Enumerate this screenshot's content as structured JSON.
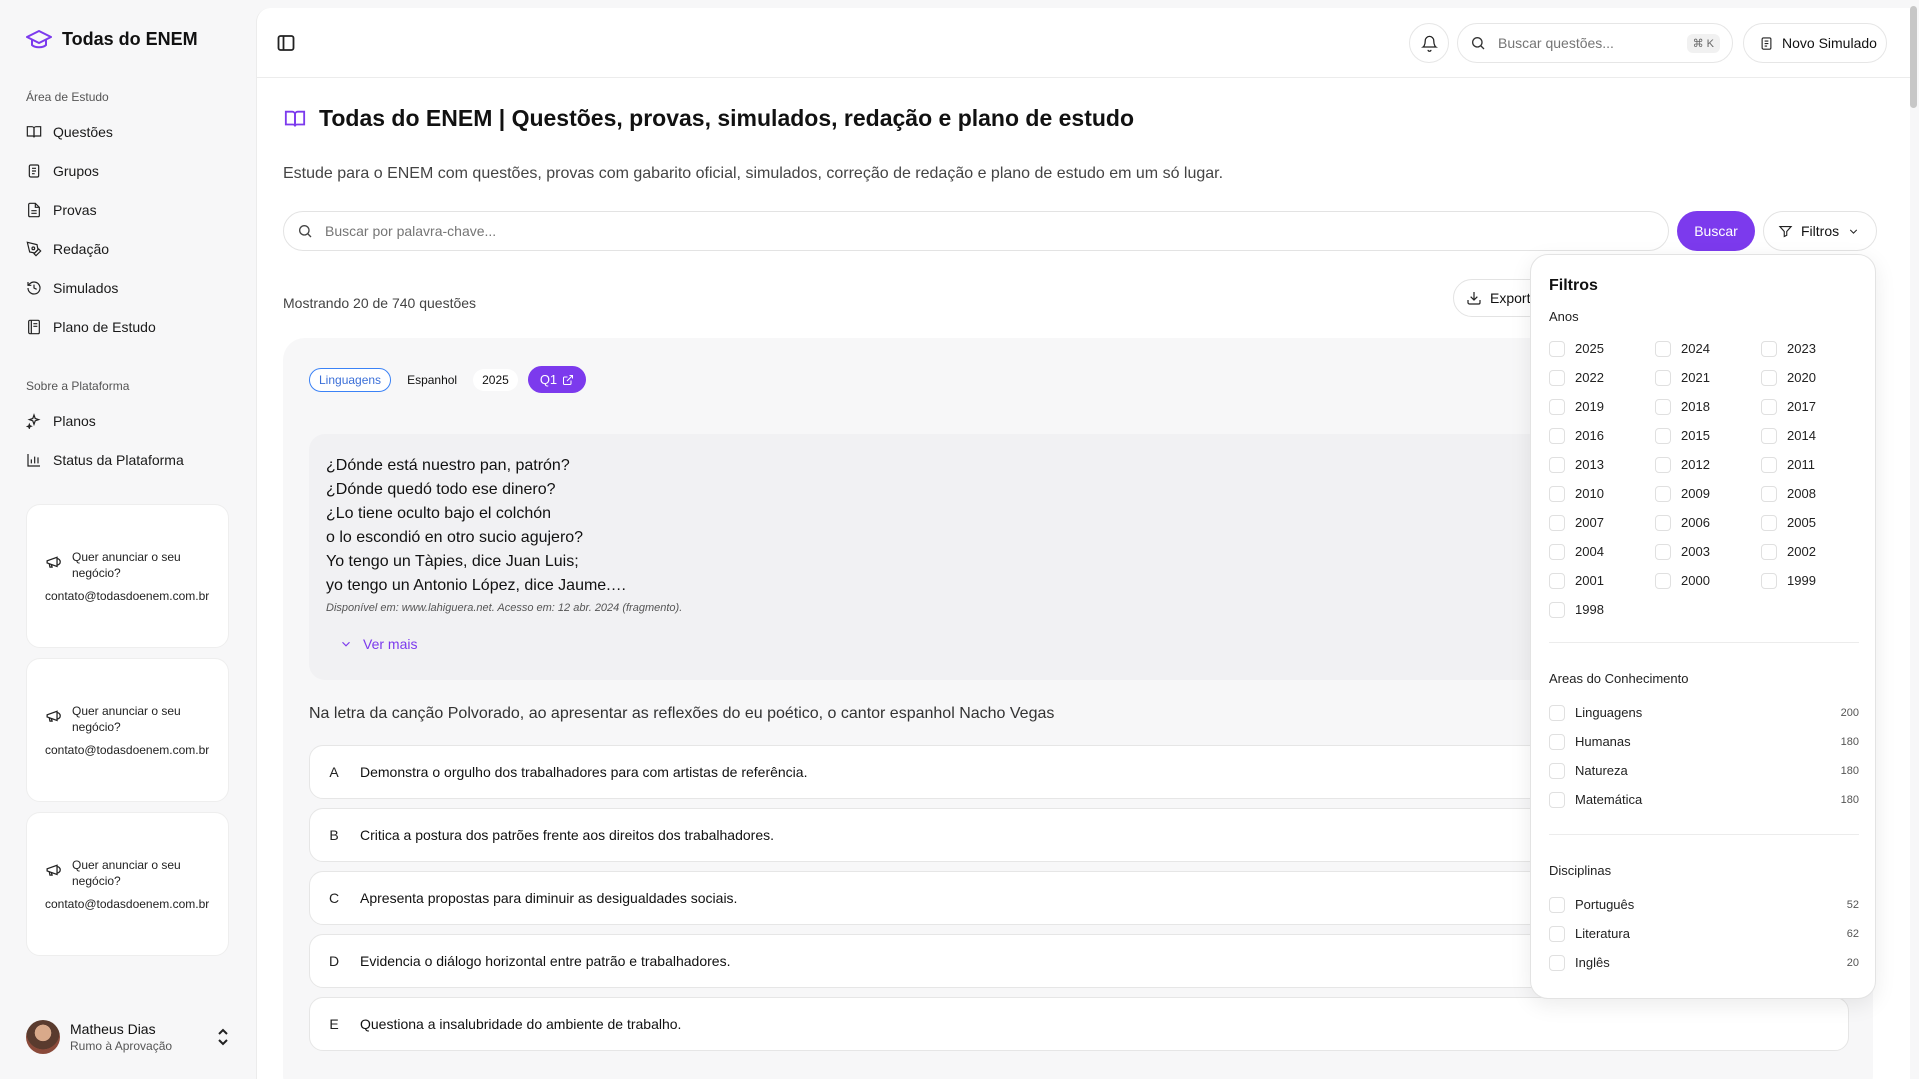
{
  "brand": {
    "name": "Todas do ENEM",
    "icon": "graduation-cap-icon"
  },
  "sidebar": {
    "section1": "Área de Estudo",
    "study_items": [
      {
        "label": "Questões",
        "icon": "book-open-icon"
      },
      {
        "label": "Grupos",
        "icon": "clipboard-icon"
      },
      {
        "label": "Provas",
        "icon": "file-text-icon"
      },
      {
        "label": "Redação",
        "icon": "pen-tool-icon"
      },
      {
        "label": "Simulados",
        "icon": "history-icon"
      },
      {
        "label": "Plano de Estudo",
        "icon": "notebook-icon"
      }
    ],
    "section2": "Sobre a Plataforma",
    "platform_items": [
      {
        "label": "Planos",
        "icon": "sparkles-icon"
      },
      {
        "label": "Status da Plataforma",
        "icon": "bar-chart-icon"
      }
    ],
    "ads": [
      {
        "title": "Quer anunciar o seu negócio?",
        "email": "contato@todasdoenem.com.br"
      },
      {
        "title": "Quer anunciar o seu negócio?",
        "email": "contato@todasdoenem.com.br"
      },
      {
        "title": "Quer anunciar o seu negócio?",
        "email": "contato@todasdoenem.com.br"
      }
    ],
    "user": {
      "name": "Matheus Dias",
      "subtitle": "Rumo à Aprovação"
    }
  },
  "topbar": {
    "search_placeholder": "Buscar questões...",
    "shortcut": "⌘ K",
    "new_exam_label": "Novo Simulado"
  },
  "page": {
    "title": "Todas do ENEM | Questões, provas, simulados, redação e plano de estudo",
    "subtitle": "Estude para o ENEM com questões, provas com gabarito oficial, simulados, correção de redação e plano de estudo em um só lugar.",
    "keyword_placeholder": "Buscar por palavra-chave...",
    "search_label": "Buscar",
    "filters_label": "Filtros",
    "showing": "Mostrando 20 de 740 questões",
    "export_label": "Exportar"
  },
  "question": {
    "area_tag": "Linguagens",
    "subject_tag": "Espanhol",
    "year_tag": "2025",
    "number_tag": "Q1",
    "verses": [
      "¿Dónde está nuestro pan, patrón?",
      "¿Dónde quedó todo ese dinero?",
      "¿Lo tiene oculto bajo el colchón",
      "o lo escondió en otro sucio agujero?",
      "Yo tengo un Tàpies, dice Juan Luis;",
      "yo tengo un Antonio López, dice Jaume.…"
    ],
    "source": "Disponível em: www.lahiguera.net. Acesso em: 12 abr. 2024 (fragmento).",
    "see_more": "Ver mais",
    "stem": "Na letra da canção Polvorado, ao apresentar as reflexões do eu poético, o cantor espanhol Nacho Vegas",
    "options": [
      {
        "letter": "A",
        "text": "Demonstra o orgulho dos trabalhadores para com artistas de referência."
      },
      {
        "letter": "B",
        "text": "Critica a postura dos patrões frente aos direitos dos trabalhadores."
      },
      {
        "letter": "C",
        "text": "Apresenta propostas para diminuir as desigualdades sociais."
      },
      {
        "letter": "D",
        "text": "Evidencia o diálogo horizontal entre patrão e trabalhadores."
      },
      {
        "letter": "E",
        "text": "Questiona a insalubridade do ambiente de trabalho."
      }
    ]
  },
  "filters": {
    "title": "Filtros",
    "years_label": "Anos",
    "years": [
      "2025",
      "2024",
      "2023",
      "2022",
      "2021",
      "2020",
      "2019",
      "2018",
      "2017",
      "2016",
      "2015",
      "2014",
      "2013",
      "2012",
      "2011",
      "2010",
      "2009",
      "2008",
      "2007",
      "2006",
      "2005",
      "2004",
      "2003",
      "2002",
      "2001",
      "2000",
      "1999",
      "1998"
    ],
    "areas_label": "Areas do Conhecimento",
    "areas": [
      {
        "label": "Linguagens",
        "count": "200"
      },
      {
        "label": "Humanas",
        "count": "180"
      },
      {
        "label": "Natureza",
        "count": "180"
      },
      {
        "label": "Matemática",
        "count": "180"
      }
    ],
    "disciplines_label": "Disciplinas",
    "disciplines": [
      {
        "label": "Português",
        "count": "52"
      },
      {
        "label": "Literatura",
        "count": "62"
      },
      {
        "label": "Inglês",
        "count": "20"
      }
    ]
  },
  "colors": {
    "accent": "#7c3aed",
    "tag_blue": "#3b82f6"
  }
}
